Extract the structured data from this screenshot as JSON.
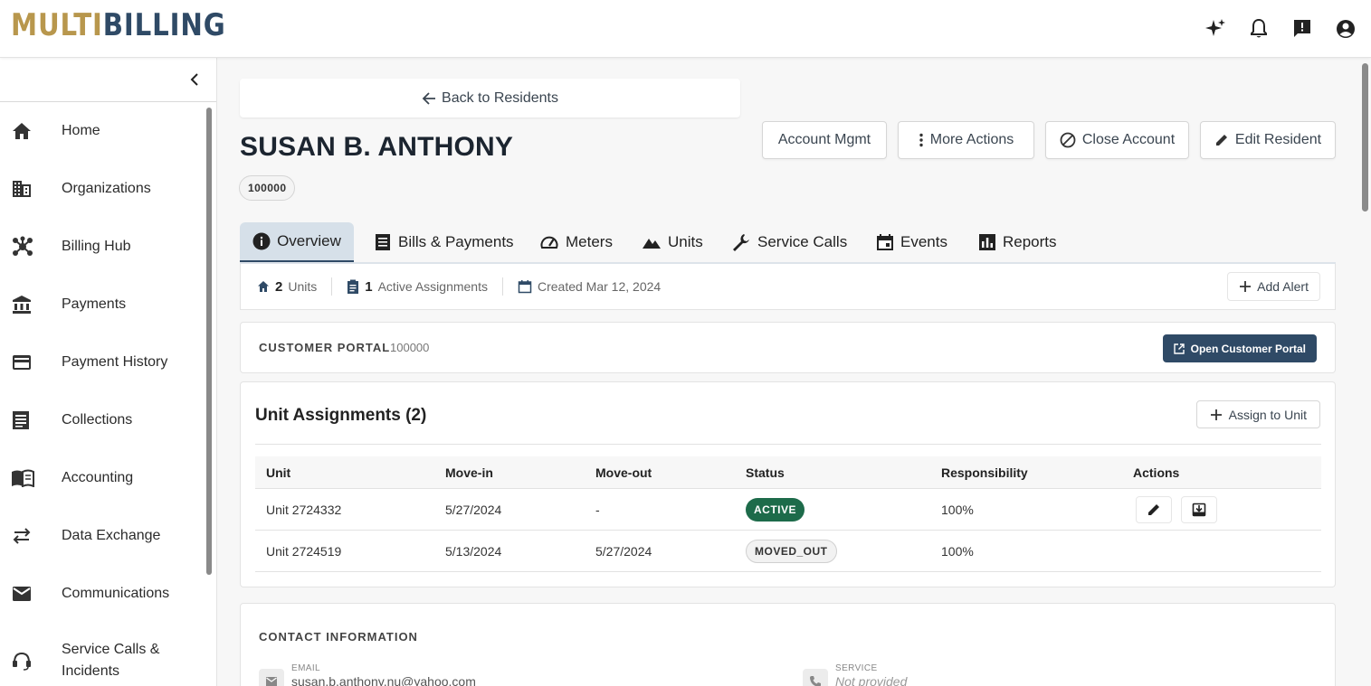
{
  "brand": {
    "part1": "MULTI",
    "part2": "BILLING",
    "color1": "#b8974d",
    "color2": "#2f4a66"
  },
  "topbar": {
    "icons": [
      "sparkle-icon",
      "bell-icon",
      "feedback-icon",
      "account-icon"
    ]
  },
  "sidebar": {
    "items": [
      {
        "label": "Home",
        "icon": "home-icon"
      },
      {
        "label": "Organizations",
        "icon": "building-icon"
      },
      {
        "label": "Billing Hub",
        "icon": "hub-icon"
      },
      {
        "label": "Payments",
        "icon": "bank-icon"
      },
      {
        "label": "Payment History",
        "icon": "credit-card-icon"
      },
      {
        "label": "Collections",
        "icon": "list-icon"
      },
      {
        "label": "Accounting",
        "icon": "book-icon"
      },
      {
        "label": "Data Exchange",
        "icon": "swap-icon"
      },
      {
        "label": "Communications",
        "icon": "mail-icon"
      },
      {
        "label": "Service Calls & Incidents",
        "icon": "support-icon"
      }
    ]
  },
  "resident": {
    "back_label": "Back to Residents",
    "name": "SUSAN B. ANTHONY",
    "account_number": "100000"
  },
  "actions": {
    "account_mgmt": "Account Mgmt",
    "more_actions": "More Actions",
    "close_account": "Close Account",
    "edit_resident": "Edit Resident"
  },
  "tabs": [
    {
      "label": "Overview",
      "icon": "info-icon",
      "active": true
    },
    {
      "label": "Bills & Payments",
      "icon": "receipt-icon",
      "active": false
    },
    {
      "label": "Meters",
      "icon": "speedometer-icon",
      "active": false
    },
    {
      "label": "Units",
      "icon": "landscape-icon",
      "active": false
    },
    {
      "label": "Service Calls",
      "icon": "wrench-icon",
      "active": false
    },
    {
      "label": "Events",
      "icon": "calendar-icon",
      "active": false
    },
    {
      "label": "Reports",
      "icon": "bar-chart-icon",
      "active": false
    }
  ],
  "summary": {
    "units_count": "2",
    "units_label": "Units",
    "assignments_count": "1",
    "assignments_label": "Active Assignments",
    "created": "Created Mar 12, 2024",
    "add_alert": "Add Alert"
  },
  "portal": {
    "label": "CUSTOMER PORTAL",
    "number": "100000",
    "button": "Open Customer Portal"
  },
  "unit_assignments": {
    "title": "Unit Assignments (2)",
    "assign_button": "Assign to Unit",
    "columns": [
      "Unit",
      "Move-in",
      "Move-out",
      "Status",
      "Responsibility",
      "Actions"
    ],
    "rows": [
      {
        "unit": "Unit 2724332",
        "move_in": "5/27/2024",
        "move_out": "-",
        "status": "ACTIVE",
        "responsibility": "100%"
      },
      {
        "unit": "Unit 2724519",
        "move_in": "5/13/2024",
        "move_out": "5/27/2024",
        "status": "MOVED_OUT",
        "responsibility": "100%"
      }
    ]
  },
  "contact": {
    "title": "CONTACT INFORMATION",
    "email_label": "EMAIL",
    "email_value": "susan.b.anthony.nu@yahoo.com",
    "service_label": "SERVICE",
    "service_value": "Not provided"
  },
  "colors": {
    "primary": "#2f4a66",
    "active_badge": "#1d6b4a",
    "tab_active_bg": "#d6e0e9"
  }
}
